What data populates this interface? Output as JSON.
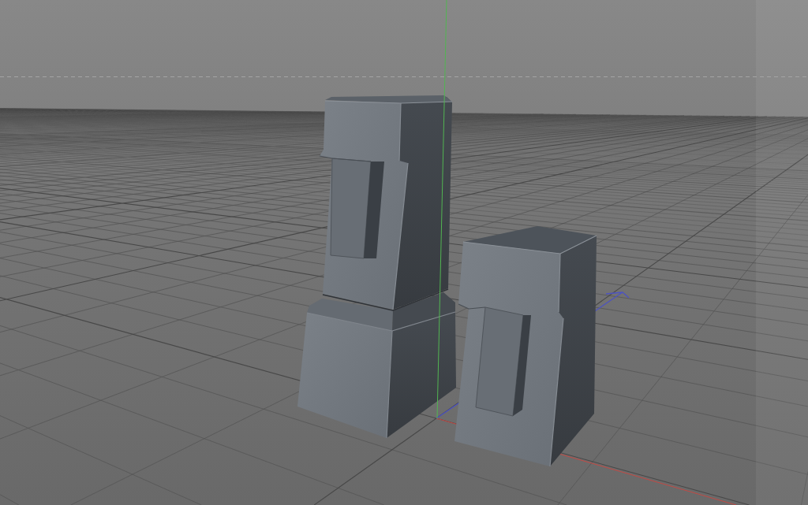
{
  "viewport": {
    "models": [
      {
        "kind": "stacked"
      },
      {
        "kind": "block"
      }
    ]
  }
}
